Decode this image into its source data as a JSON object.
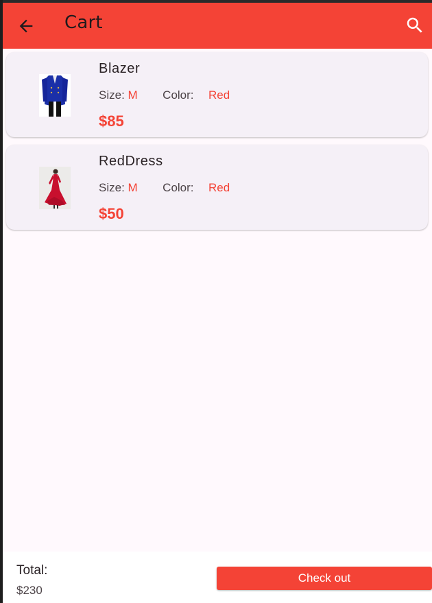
{
  "appbar": {
    "title": "Cart",
    "back_icon": "arrow-back-icon",
    "search_icon": "search-icon",
    "color": "#f44336"
  },
  "labels": {
    "size": "Size:",
    "color": "Color:"
  },
  "items": [
    {
      "name": "Blazer",
      "size": "M",
      "color": "Red",
      "price": "$85",
      "image": "blue-blazer-image"
    },
    {
      "name": "RedDress",
      "size": "M",
      "color": "Red",
      "price": "$50",
      "image": "red-dress-image"
    }
  ],
  "footer": {
    "total_label": "Total:",
    "total_value": "$230",
    "checkout_label": "Check out"
  },
  "colors": {
    "accent": "#f44336",
    "background": "#fff9fd",
    "card": "#f5f0f7"
  }
}
